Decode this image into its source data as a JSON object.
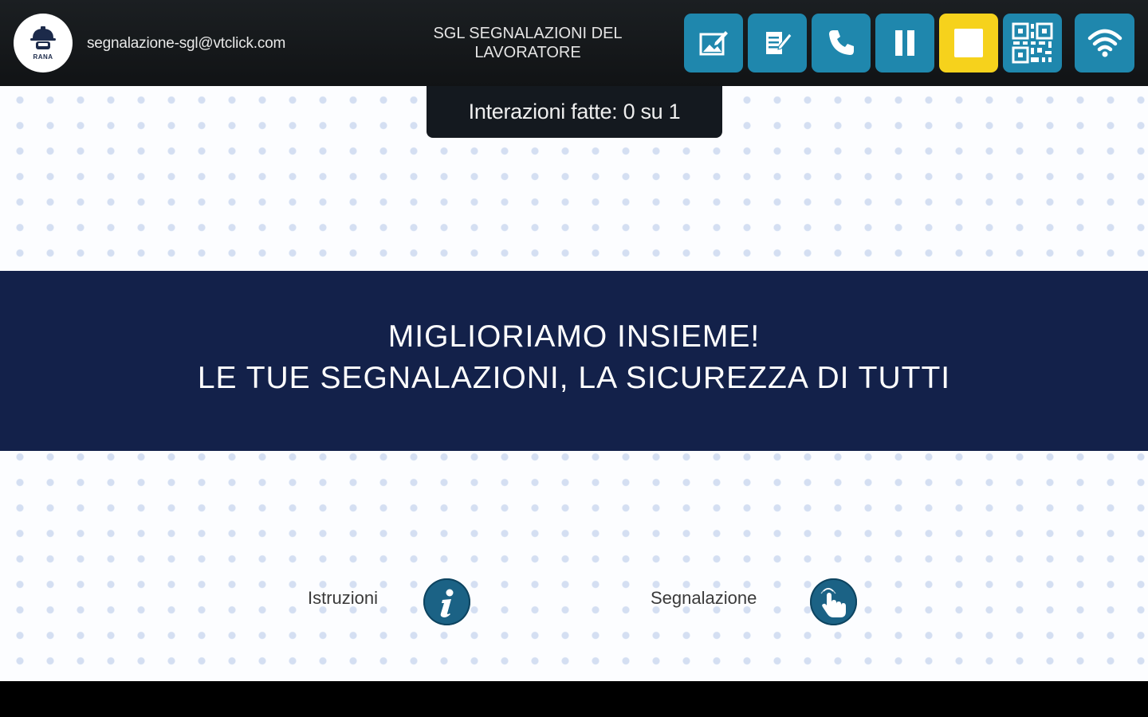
{
  "header": {
    "logo_text": "RANA",
    "email": "segnalazione-sgl@vtclick.com",
    "title_line1": "SGL SEGNALAZIONI DEL",
    "title_line2": "LAVORATORE",
    "toolbar": [
      {
        "name": "edit-image-button",
        "icon": "edit-image-icon"
      },
      {
        "name": "checklist-button",
        "icon": "checklist-edit-icon"
      },
      {
        "name": "phone-button",
        "icon": "phone-icon"
      },
      {
        "name": "pause-button",
        "icon": "pause-icon"
      },
      {
        "name": "stop-button",
        "icon": "stop-icon",
        "color": "#f6d21c"
      },
      {
        "name": "qr-code-button",
        "icon": "qr-code-icon"
      },
      {
        "name": "wifi-button",
        "icon": "wifi-icon"
      }
    ],
    "accent_color": "#1f87ad"
  },
  "counter": {
    "text": "Interazioni fatte: 0 su 1"
  },
  "banner": {
    "line1": "MIGLIORIAMO INSIEME!",
    "line2": "LE TUE SEGNALAZIONI, LA SICUREZZA DI TUTTI",
    "background": "#13214a"
  },
  "actions": {
    "istruzioni": {
      "label": "Istruzioni",
      "icon": "info-icon"
    },
    "segnalazione": {
      "label": "Segnalazione",
      "icon": "hand-touch-icon"
    }
  }
}
